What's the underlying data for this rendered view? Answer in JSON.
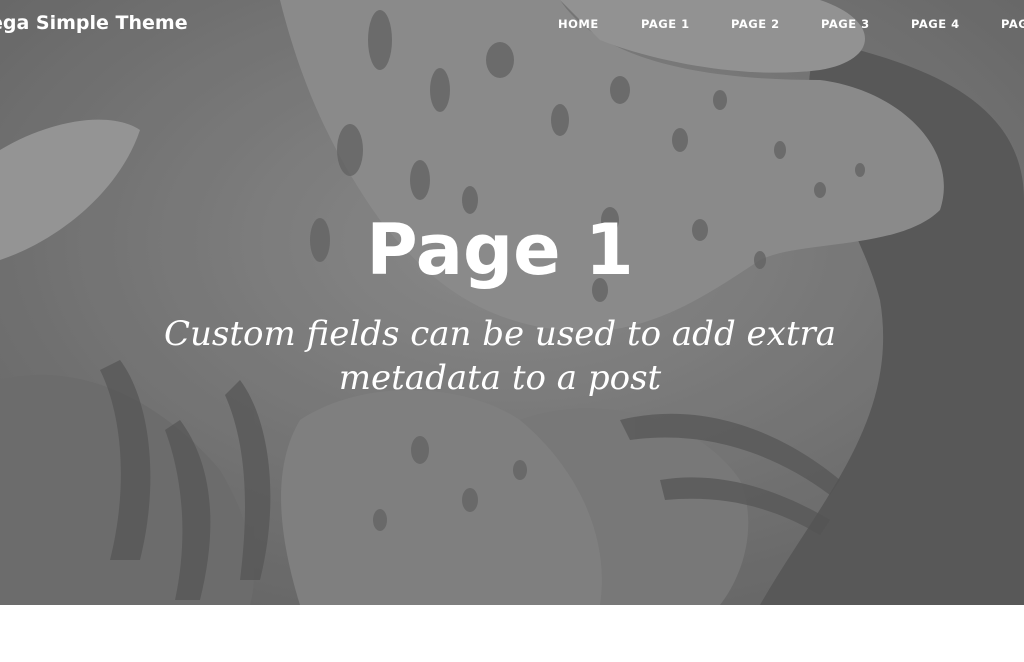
{
  "header": {
    "site_title": "ega Simple Theme",
    "nav": [
      {
        "label": "HOME"
      },
      {
        "label": "PAGE 1"
      },
      {
        "label": "PAGE 2"
      },
      {
        "label": "PAGE 3"
      },
      {
        "label": "PAGE 4"
      },
      {
        "label": "PAG"
      }
    ]
  },
  "hero": {
    "title": "Page 1",
    "subtitle": "Custom fields can be used to add extra metadata to a post"
  }
}
